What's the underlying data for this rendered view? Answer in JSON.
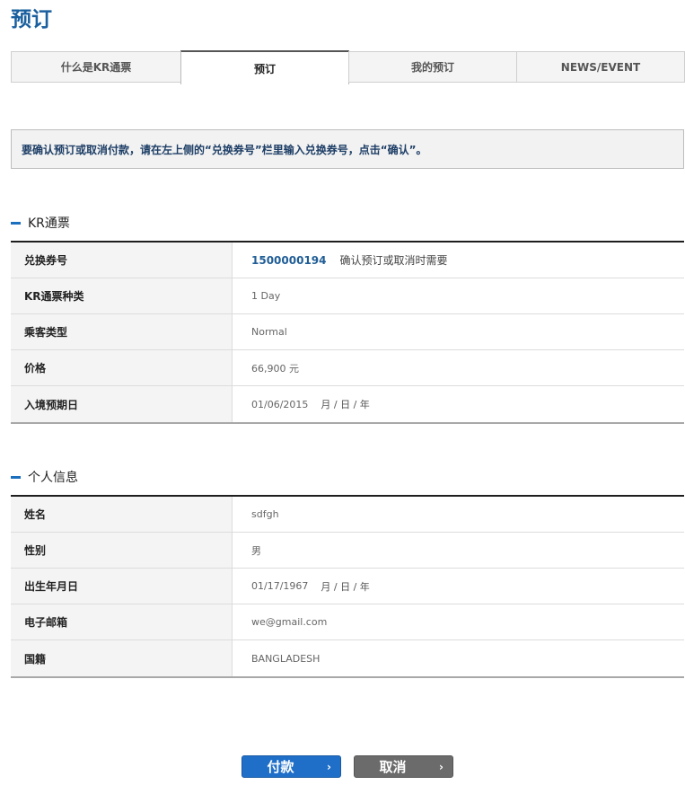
{
  "page_title": "预订",
  "tabs": [
    {
      "label": "什么是KR通票",
      "active": false
    },
    {
      "label": "预订",
      "active": true
    },
    {
      "label": "我的预订",
      "active": false
    },
    {
      "label": "NEWS/EVENT",
      "active": false
    }
  ],
  "notice": "要确认预订或取消付款，请在左上侧的“兑换券号”栏里输入兑换券号，点击“确认”。",
  "pass_section": {
    "heading": "KR通票",
    "rows": {
      "voucher": {
        "label": "兑换券号",
        "value": "1500000194",
        "hint": "确认预订或取消时需要"
      },
      "pass_type": {
        "label": "KR通票种类",
        "value": "1 Day"
      },
      "passenger_type": {
        "label": "乘客类型",
        "value": "Normal"
      },
      "price": {
        "label": "价格",
        "value": "66,900 元"
      },
      "entry_date": {
        "label": "入境预期日",
        "value": "01/06/2015",
        "format": "月 / 日 / 年"
      }
    }
  },
  "personal_section": {
    "heading": "个人信息",
    "rows": {
      "name": {
        "label": "姓名",
        "value": "sdfgh"
      },
      "gender": {
        "label": "性别",
        "value": "男"
      },
      "birth_date": {
        "label": "出生年月日",
        "value": "01/17/1967",
        "format": "月 / 日 / 年"
      },
      "email": {
        "label": "电子邮箱",
        "value": "we@gmail.com"
      },
      "nationality": {
        "label": "国籍",
        "value": "BANGLADESH"
      }
    }
  },
  "buttons": {
    "pay": "付款",
    "cancel": "取消",
    "arrow_glyph": "›"
  },
  "colors": {
    "title": "#1a5f9e",
    "accent_bar": "#1a6fbf",
    "pay_button": "#1f6fc9",
    "cancel_button": "#6b6b6b",
    "voucher_text": "#1f5d96"
  }
}
